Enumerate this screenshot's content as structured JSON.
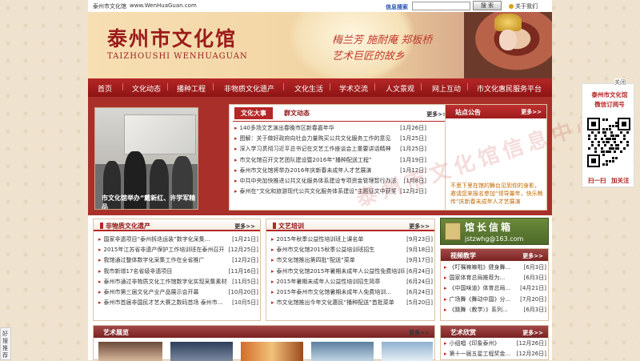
{
  "topbar": {
    "site_name": "泰州市文化馆",
    "url": "www.WenHuaGuan.com",
    "search_label": "信息搜索",
    "search_value": "",
    "search_button": "搜  索",
    "about": "关于我们"
  },
  "banner": {
    "title": "泰州市文化馆",
    "subtitle": "TAIZHOUSHI WENHUAGUAN",
    "slogan1": "梅兰芳  施耐庵  郑板桥",
    "slogan2": "艺术巨匠的故乡"
  },
  "nav": [
    "首页",
    "文化动态",
    "播种工程",
    "非物质文化遗产",
    "文化生活",
    "学术交流",
    "人文景观",
    "网上互动",
    "市文化惠民服务平台"
  ],
  "feature": {
    "caption": "市文化馆举办“戴新红、许学军精品"
  },
  "news": {
    "tab_active": "文化大事",
    "tab_other": "群文动态",
    "more": "更多>>",
    "items": [
      {
        "title": "140多场文艺演出春晚市区新春嘉年华",
        "date": "[1月26日]"
      },
      {
        "title": "图解：关于做好政府向社会力量购买公共文化服务工作的意见",
        "date": "[1月25日]"
      },
      {
        "title": "深入学习贯彻习近平总书记在文艺工作座谈会上重要讲话精神",
        "date": "[1月25日]"
      },
      {
        "title": "市文化馆召开文艺团队建设暨2016年“播种配送工程”",
        "date": "[1月19日]"
      },
      {
        "title": "泰州市文化馆将举办2016年庆新春未成年人才艺展演",
        "date": "[1月12日]"
      },
      {
        "title": "中共中央加快推进公共文化服务体系建设专项资金管理暂行办法",
        "date": "[1月8日]"
      },
      {
        "title": "泰州在“文化和旅游现代公共文化服务体系建设”主题征文中获奖",
        "date": "[12月2日]"
      }
    ]
  },
  "notice": {
    "title": "站点公告",
    "more": "更多>>",
    "text": "不思下里在馆的舞台见到你的身影，邀请您来报名参加“领导量年，快乐畅传”庆新春未成年人才艺展演"
  },
  "heritage": {
    "title": "非物质文化遗产",
    "more": "更多>>",
    "items": [
      {
        "title": "国家非遗项目“泰州拆迭运装”数字化采集...",
        "date": "[1月21日]"
      },
      {
        "title": "2015年江苏省非遗产保护工作培训班在泰州召开",
        "date": "[12月25日]"
      },
      {
        "title": "我馆通过整体数字化采集工作在全省推广",
        "date": "[12月2日]"
      },
      {
        "title": "我市新增17名省级非遗项目",
        "date": "[11月16日]"
      },
      {
        "title": "泰州市通过非物质文化工作馆数字化实现采集素材",
        "date": "[11月5日]"
      },
      {
        "title": "泰州市第三届文化产业产品展示会开幕",
        "date": "[10月20日]"
      },
      {
        "title": "泰州市首届非国民才艺大赛之数码首场 泰州市...",
        "date": "[10月5日]"
      }
    ]
  },
  "training": {
    "title": "文艺培训",
    "more": "更多>>",
    "items": [
      {
        "title": "2015年秋季公益性培训班上课名单",
        "date": "[9月23日]"
      },
      {
        "title": "泰州市文化馆2015秋季公益培训班招生",
        "date": "[9月18日]"
      },
      {
        "title": "市文化馆推出第四批“配送”菜单",
        "date": "[9月17日]"
      },
      {
        "title": "泰州市文化馆2015年暑期未成年人公益性免费培训班课...",
        "date": "[6月24日]"
      },
      {
        "title": "2015年暑期未成年人公益性培训招生简章",
        "date": "[6月24日]"
      },
      {
        "title": "2015年泰州市文化馆暑期未成年人免费培训...",
        "date": "[6月24日]"
      },
      {
        "title": "市文化馆推出今年文化惠民“播种配送”首批菜单",
        "date": "[5月20日]"
      }
    ]
  },
  "mailbox": {
    "title": "馆长信箱",
    "email": "jstzwhg@163.com"
  },
  "video": {
    "title": "视频教学",
    "more": "更多>>",
    "items": [
      {
        "title": "《叮嘱嘛嘛啦》健身舞...",
        "date": "[6月3日]"
      },
      {
        "title": "国家体育总局推荐为...",
        "date": "[6月3日]"
      },
      {
        "title": "《中国味道》体育总局...",
        "date": "[4月21日]"
      },
      {
        "title": "广场舞《舞动中国》分...",
        "date": "[7月20日]"
      },
      {
        "title": "《跳舞（教学）》系列...",
        "date": "[6月3日]"
      }
    ]
  },
  "art_show": {
    "title": "艺术展览",
    "more": "更多>>"
  },
  "art_appreciation": {
    "title": "艺术欣赏",
    "more": "更多>>",
    "items": [
      {
        "title": "小组唱《印象泰州》",
        "date": "[12月26日]"
      },
      {
        "title": "第十一届五星工程奖金...",
        "date": "[12月26日]"
      }
    ]
  },
  "wechat": {
    "close": "关闭",
    "line1": "泰州市文化馆",
    "line2": "微信订阅号",
    "scan": "扫一扫",
    "follow": "加关注"
  },
  "share": [
    "好",
    "搜",
    "推",
    "荐"
  ],
  "watermark": "泰州市文化馆信息中心",
  "colors": {
    "brand_red": "#b52626",
    "dark_red": "#8e1414",
    "date_blue": "#2a54b0",
    "notice_orange": "#c46a00"
  }
}
